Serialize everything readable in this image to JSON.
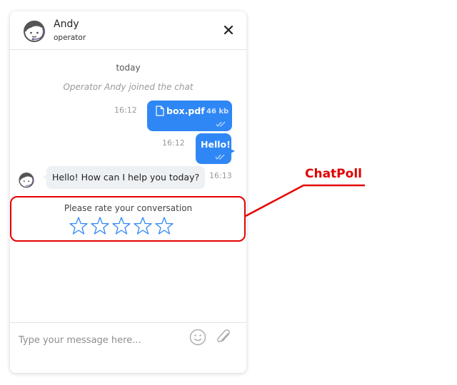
{
  "header": {
    "operator_name": "Andy",
    "operator_role": "operator",
    "close_icon": "close-icon",
    "avatar_icon": "operator-headset-avatar-icon"
  },
  "messages": {
    "date_label": "today",
    "system_text": "Operator Andy joined the chat",
    "file_message": {
      "time": "16:12",
      "file_name": "box.pdf",
      "file_size": "46 kb",
      "status_icon": "double-check-icon"
    },
    "hello_message": {
      "time": "16:12",
      "text": "Hello!",
      "status_icon": "double-check-icon"
    },
    "operator_message": {
      "time": "16:13",
      "text": "Hello! How can I help you today?"
    }
  },
  "poll": {
    "title": "Please rate your conversation",
    "stars_total": 5,
    "rating": 0
  },
  "composer": {
    "placeholder": "Type your message here...",
    "value": "",
    "emoji_icon": "emoji-icon",
    "attach_icon": "paperclip-icon"
  },
  "annotation": {
    "label": "ChatPoll",
    "color": "#e00000"
  },
  "colors": {
    "accent": "#2f87f5",
    "incoming_bubble": "#eef1f4",
    "star_outline": "#2f87f5"
  }
}
